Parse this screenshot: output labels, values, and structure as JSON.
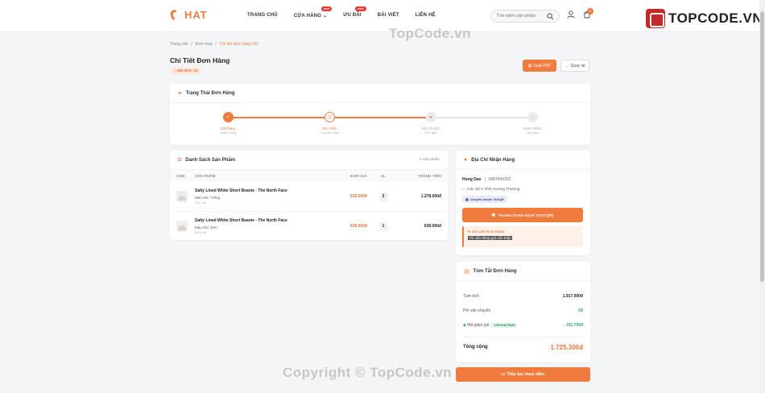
{
  "header": {
    "logo": "HAT",
    "nav": [
      {
        "label": "TRANG CHỦ",
        "badge": ""
      },
      {
        "label": "CỬA HÀNG",
        "badge": "mới"
      },
      {
        "label": "ƯU ĐÃI",
        "badge": "sale"
      },
      {
        "label": "BÀI VIẾT",
        "badge": ""
      },
      {
        "label": "LIÊN HỆ",
        "badge": ""
      }
    ],
    "search_placeholder": "Tìm kiếm sản phẩm",
    "cart_count": "0"
  },
  "brand": {
    "text": "TOPCODE.VN"
  },
  "watermarks": {
    "top": "TopCode.vn",
    "bottom": "Copyright © TopCode.vn"
  },
  "breadcrumb": [
    "Trang chủ",
    "Đơn mua",
    "Chi tiết đơn hàng #12"
  ],
  "page": {
    "title": "Chi Tiết Đơn Hàng",
    "order_code": "Mã đơn: 12",
    "export_pdf": "Xuất PDF",
    "back": "Quay lại"
  },
  "status": {
    "title": "Trạng Thái Đơn Hàng",
    "steps": [
      {
        "label": "Đặt hàng",
        "sub": "Thành công",
        "state": "done"
      },
      {
        "label": "Xác nhận",
        "sub": "Chờ xác nhận",
        "state": "current"
      },
      {
        "label": "Vận chuyển",
        "sub": "Chờ giao",
        "state": "pending"
      },
      {
        "label": "Hoàn thành",
        "sub": "Chờ giao",
        "state": "pending"
      }
    ]
  },
  "products": {
    "title": "Danh Sách Sản Phẩm",
    "count": "2 sản phẩm",
    "headers": [
      "ẢNH",
      "SẢN PHẨM",
      "ĐƠN GIÁ",
      "SL",
      "THÀNH TIỀN"
    ],
    "rows": [
      {
        "name": "Salty Lined White Short Beanie - The North Face",
        "variant": "Màu sắc: Trắng",
        "sku": "SKU: #4",
        "price": "639.000đ",
        "qty": "2",
        "total": "1.278.000đ"
      },
      {
        "name": "Salty Lined White Short Beanie - The North Face",
        "variant": "Màu sắc: Đen",
        "sku": "SKU: #4",
        "price": "639.000đ",
        "qty": "1",
        "total": "639.000đ"
      }
    ]
  },
  "address": {
    "title": "Địa Chỉ Nhận Hàng",
    "name": "Hung Dao",
    "phone": "0987654322",
    "line": "Các Số 2 Vĩnh Xương Thượng",
    "payment_method": "Chuyển khoản VietQR",
    "pay_button": "THANH TOÁN NGAY (VIETQR)",
    "note_label": "GHI CHÚ ĐƠN HÀNG",
    "note_text": "Tôi cần đóng gói cẩn thận"
  },
  "summary": {
    "title": "Tóm Tắt Đơn Hàng",
    "subtotal_label": "Tạm tính",
    "subtotal": "1.917.000đ",
    "shipping_label": "Phí vận chuyển",
    "shipping": "0đ",
    "discount_label": "Mã giảm giá",
    "coupon": "10PHANTRAM",
    "discount": "- 191.700đ",
    "total_label": "Tổng cộng",
    "total": "1.725.300đ",
    "continue_button": "Tiếp tục mua sắm"
  },
  "colors": {
    "accent": "#f07b3f",
    "success": "#3ca66a"
  }
}
